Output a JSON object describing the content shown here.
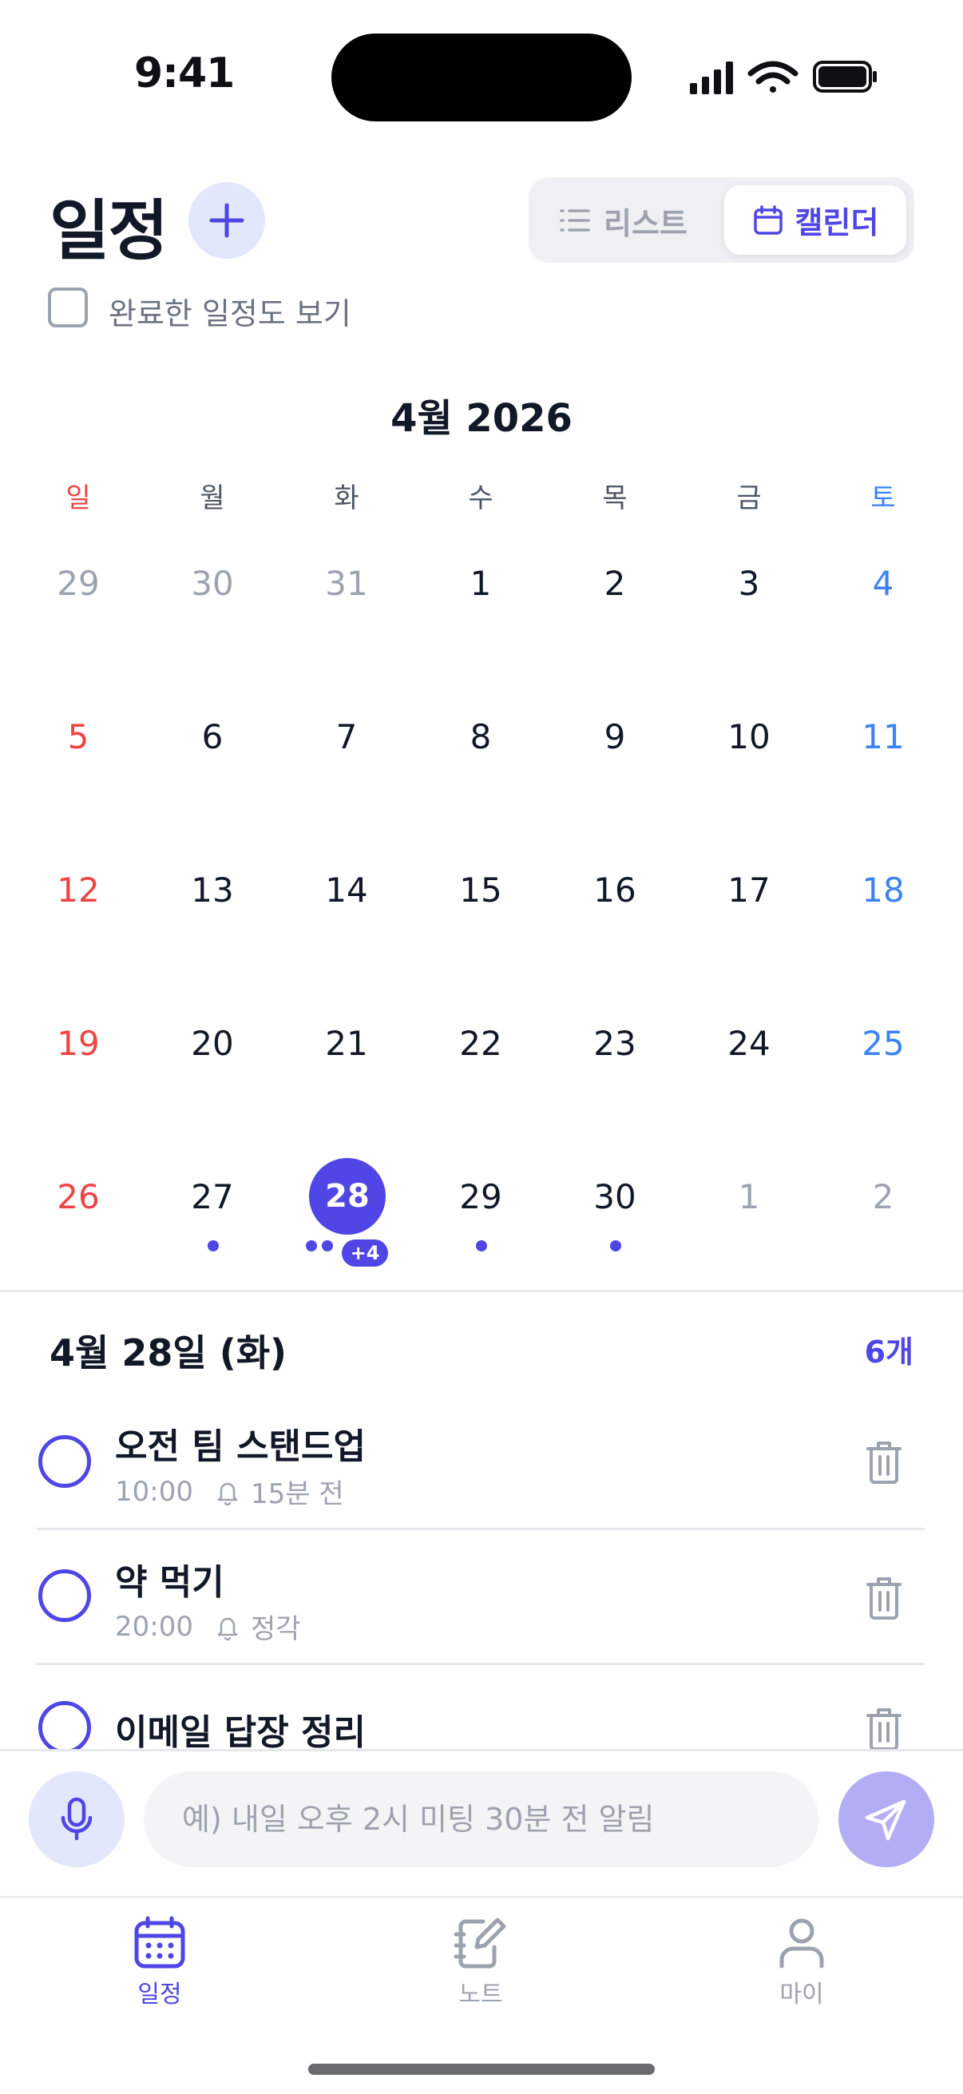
{
  "status_bar": {
    "time": "9:41"
  },
  "header": {
    "title": "일정",
    "view_toggle": {
      "list_label": "리스트",
      "calendar_label": "캘린더",
      "selected": "캘린더"
    },
    "show_completed": {
      "label": "완료한 일정도 보기",
      "checked": false
    }
  },
  "calendar": {
    "month_label": "4월 2026",
    "weekdays": [
      "일",
      "월",
      "화",
      "수",
      "목",
      "금",
      "토"
    ],
    "weeks": [
      [
        "29",
        "30",
        "31",
        "1",
        "2",
        "3",
        "4"
      ],
      [
        "5",
        "6",
        "7",
        "8",
        "9",
        "10",
        "11"
      ],
      [
        "12",
        "13",
        "14",
        "15",
        "16",
        "17",
        "18"
      ],
      [
        "19",
        "20",
        "21",
        "22",
        "23",
        "24",
        "25"
      ],
      [
        "26",
        "27",
        "28",
        "29",
        "30",
        "1",
        "2"
      ]
    ],
    "selected_day": "28",
    "selected_more_badge": "+4"
  },
  "day_detail": {
    "date_label": "4월 28일 (화)",
    "count_label": "6개",
    "tasks": [
      {
        "title": "오전 팀 스탠드업",
        "time": "10:00",
        "reminder": "15분 전"
      },
      {
        "title": "약 먹기",
        "time": "20:00",
        "reminder": "정각"
      },
      {
        "title": "이메일 답장 정리",
        "time": "",
        "reminder": ""
      }
    ]
  },
  "composer": {
    "placeholder": "예) 내일 오후 2시 미팅 30분 전 알림"
  },
  "tabbar": {
    "items": [
      {
        "label": "일정",
        "icon": "calendar-icon",
        "active": true
      },
      {
        "label": "노트",
        "icon": "note-icon",
        "active": false
      },
      {
        "label": "마이",
        "icon": "person-icon",
        "active": false
      }
    ]
  },
  "colors": {
    "accent": "#4f46e5",
    "accent_light": "#e3e7fc",
    "sunday": "#ef4444",
    "saturday": "#3b82f6",
    "muted": "#9ca3af"
  }
}
